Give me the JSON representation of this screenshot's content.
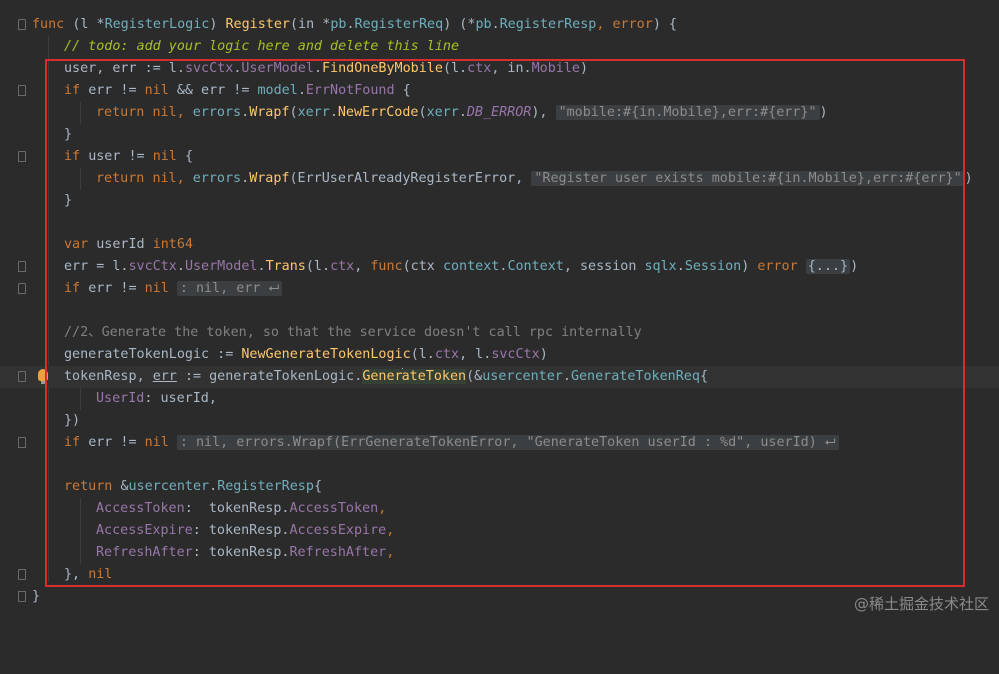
{
  "code": {
    "l1": {
      "a": "func ",
      "b": "(l *",
      "c": "RegisterLogic",
      "d": ") ",
      "e": "Register",
      "f": "(in *",
      "g": "pb",
      "h": ".",
      "i": "RegisterReq",
      "j": ") (*",
      "k": "pb",
      "l": ".",
      "m": "RegisterResp",
      ",": ", ",
      "n": "error",
      "o": ") {"
    },
    "l2": {
      "a": "// todo: add your logic here and delete this line"
    },
    "l3": {
      "a": "user, err := l.",
      "b": "svcCtx",
      "c": ".",
      "d": "UserModel",
      ".": ".",
      "e": "FindOneByMobile",
      "f": "(l.",
      "g": "ctx",
      ",": ", in.",
      "h": "Mobile",
      ")": ")"
    },
    "l4": {
      "a": "if ",
      "b": "err != ",
      "c": "nil ",
      "d": "&& err != ",
      "e": "model",
      ".": ".",
      "f": "ErrNotFound",
      "g": " {"
    },
    "l5": {
      "a": "return ",
      "b": "nil",
      ",": ", ",
      "c": "errors",
      ".": ".",
      "d": "Wrapf",
      "e": "(",
      "f": "xerr",
      ".2": ".",
      "g": "NewErrCode",
      "h": "(",
      "i": "xerr",
      ".3": ".",
      "j": "DB_ERROR",
      "k": "), ",
      "l": "\"mobile:#{in.Mobile},err:#{err}\"",
      "m": ")"
    },
    "l6": {
      "a": "}"
    },
    "l7": {
      "a": "if ",
      "b": "user != ",
      "c": "nil ",
      "d": "{"
    },
    "l8": {
      "a": "return ",
      "b": "nil",
      ",": ", ",
      "c": "errors",
      ".": ".",
      "d": "Wrapf",
      "e": "(ErrUserAlreadyRegisterError, ",
      "f": "\"Register user exists mobile:#{in.Mobile},err:#{err}\"",
      "g": ")"
    },
    "l9": {
      "a": "}"
    },
    "l10": {
      "a": "var ",
      "b": "userId ",
      "c": "int64"
    },
    "l11": {
      "a": "err = l.",
      "b": "svcCtx",
      ".": ".",
      "c": "UserModel",
      ".2": ".",
      "d": "Trans",
      "e": "(l.",
      "f": "ctx",
      ",": ", ",
      "g": "func",
      "h": "(ctx ",
      "i": "context",
      ".3": ".",
      "j": "Context",
      ",2": ", session ",
      "k": "sqlx",
      ".4": ".",
      "l": "Session",
      ")": ") ",
      "m": "error ",
      "n": "{...}",
      "o": ")"
    },
    "l12": {
      "a": "if ",
      "b": "err != ",
      "c": "nil ",
      "d": ": nil, err ⮠"
    },
    "l13": {
      "a": "//2、Generate the token, so that the service doesn't call rpc internally"
    },
    "l14": {
      "a": "generateTokenLogic := ",
      "b": "NewGenerateTokenLogic",
      "c": "(l.",
      "d": "ctx",
      ",": ", l.",
      "e": "svcCtx",
      ")": ")"
    },
    "l15": {
      "a": "tokenResp",
      "b": ", ",
      "c": "err",
      " ": " := generateTokenLogic.",
      "d": "Gener",
      "e": "ateToken",
      "f": "(&",
      "g": "usercenter",
      ".": ".",
      "h": "GenerateTokenReq",
      "i": "{"
    },
    "l16": {
      "a": "UserId",
      ":": ": userId,"
    },
    "l17": {
      "a": "})"
    },
    "l18": {
      "a": "if ",
      "b": "err != ",
      "c": "nil ",
      "d": ": nil, errors.Wrapf(ErrGenerateTokenError, \"GenerateToken userId : %d\", userId) ⮠"
    },
    "l19": {
      "a": "return ",
      "b": "&",
      "c": "usercenter",
      ".": ".",
      "d": "RegisterResp",
      "e": "{"
    },
    "l20": {
      "a": "AccessToken",
      ":": ":  tokenResp.",
      "b": "AccessToken",
      ",": ","
    },
    "l21": {
      "a": "AccessExpire",
      ":": ": tokenResp.",
      "b": "AccessExpire",
      ",": ","
    },
    "l22": {
      "a": "RefreshAfter",
      ":": ": tokenResp.",
      "b": "RefreshAfter",
      ",": ","
    },
    "l23": {
      "a": "}, ",
      "b": "nil"
    },
    "l24": {
      "a": "}"
    }
  },
  "watermark": "@稀土掘金技术社区",
  "colors": {
    "background": "#2b2b2b",
    "keyword": "#cc7832",
    "function": "#ffc66d",
    "type": "#6fafbd",
    "field": "#9876aa",
    "string": "#6a8759",
    "comment": "#808080",
    "highlight_box": "#d62d2d"
  },
  "icons": [
    "fold-marker-icon",
    "lightbulb-icon"
  ]
}
